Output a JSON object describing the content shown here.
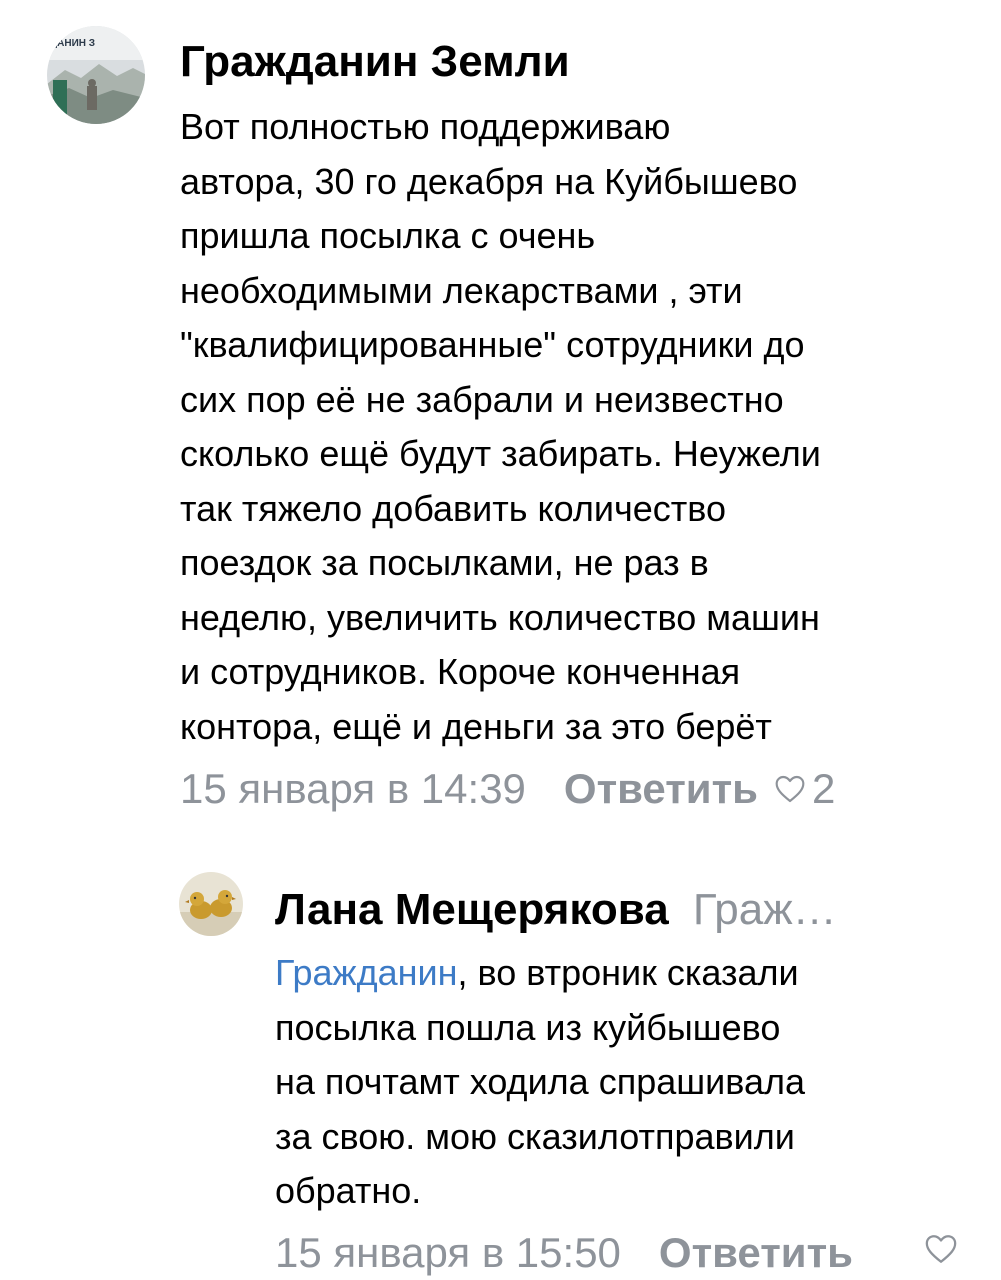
{
  "comments": [
    {
      "author": "Гражданин Земли",
      "avatar_caption": "ДАНИН З",
      "avatar_icon": "landscape-avatar-icon",
      "body_lines": [
        "Вот полностью поддерживаю",
        "автора, 30 го декабря на Куйбышево",
        "пришла посылка с очень",
        "необходимыми лекарствами , эти",
        "\"квалифицированные\" сотрудники до",
        "сих пор её не забрали и неизвестно",
        "сколько ещё будут забирать. Неужели",
        "так тяжело добавить количество",
        "поездок за посылками, не раз в",
        "неделю, увеличить количество машин",
        "и сотрудников. Короче конченная",
        "контора, ещё и деньги за это берёт"
      ],
      "date": "15 января в 14:39",
      "reply_label": "Ответить",
      "likes": "2"
    }
  ],
  "replies": [
    {
      "author": "Лана Мещерякова",
      "reply_to": "Граж…",
      "mention": "Гражданин",
      "first_line_rest": ", во втроник сказали",
      "body_lines": [
        "посылка пошла из куйбышево",
        "на почтамт ходила спрашивала",
        "за свою. мою сказилотправили",
        "обратно."
      ],
      "date": "15 января в 15:50",
      "reply_label": "Ответить",
      "avatar_icon": "ducklings-avatar-icon"
    }
  ],
  "colors": {
    "text": "#000000",
    "secondary": "#8e939a",
    "link": "#3d7bc6",
    "background": "#ffffff"
  }
}
